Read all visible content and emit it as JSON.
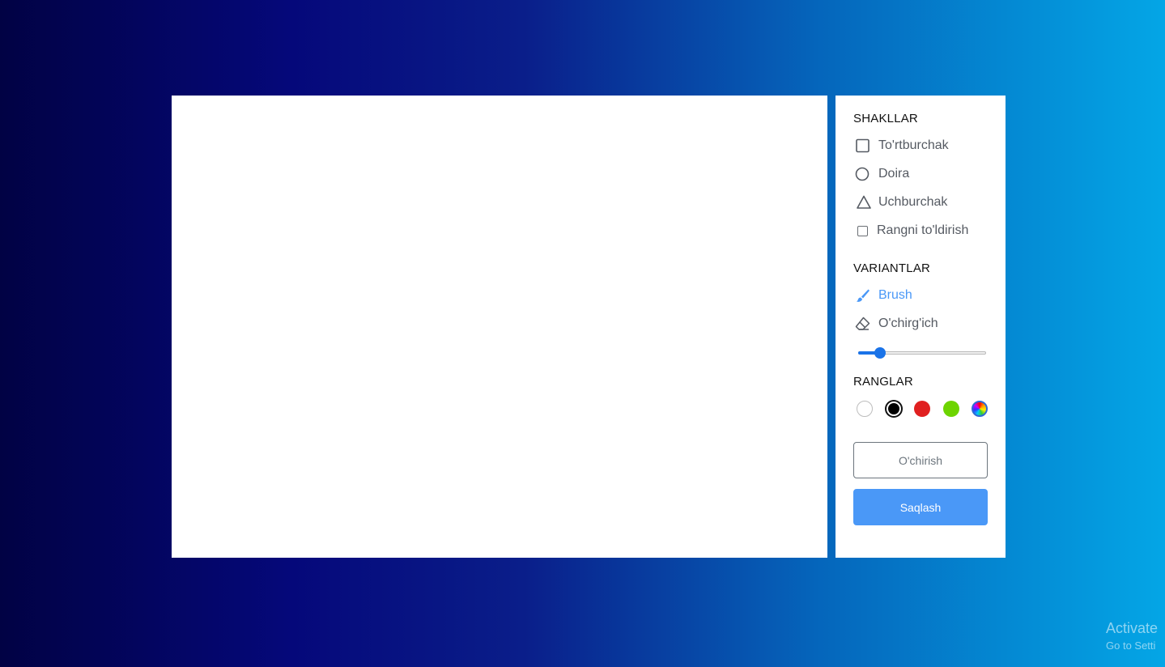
{
  "colors": {
    "accent": "#4a98f7",
    "slider": "#1a73e8",
    "background_start": "#010244",
    "background_end": "#04a6e6"
  },
  "shapes": {
    "title": "SHAKLLAR",
    "rectangle": {
      "label": "To'rtburchak",
      "icon": "square-icon"
    },
    "circle": {
      "label": "Doira",
      "icon": "circle-icon"
    },
    "triangle": {
      "label": "Uchburchak",
      "icon": "triangle-icon"
    },
    "fill_color": {
      "label": "Rangni to'ldirish",
      "checked": false
    }
  },
  "options": {
    "title": "VARIANTLAR",
    "brush": {
      "label": "Brush",
      "icon": "brush-icon",
      "active": true
    },
    "eraser": {
      "label": "O'chirg'ich",
      "icon": "eraser-icon",
      "active": false
    },
    "size_slider_percent": 17
  },
  "palette": {
    "title": "RANGLAR",
    "swatches": [
      {
        "color": "#ffffff",
        "selected": false
      },
      {
        "color": "#000000",
        "selected": true
      },
      {
        "color": "#e02020",
        "selected": false
      },
      {
        "color": "#6dd400",
        "selected": false
      },
      {
        "color": "multicolor",
        "selected": false,
        "icon": "color-picker-icon"
      }
    ]
  },
  "buttons": {
    "clear_label": "O'chirish",
    "save_label": "Saqlash"
  },
  "watermark": {
    "line1": "Activate",
    "line2": "Go to Setti"
  }
}
